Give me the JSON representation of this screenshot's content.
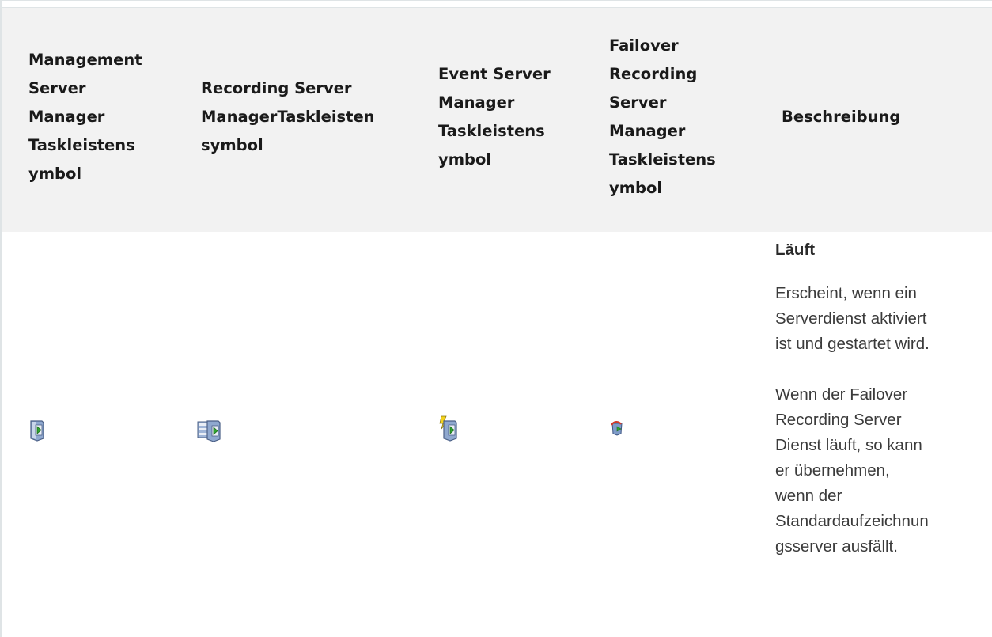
{
  "table": {
    "headers": [
      "Management\nServer\nManager\nTaskleistens\nymbol",
      "Recording Server\nManagerTaskleisten\nsymbol",
      "Event Server\nManager\nTaskleistens\nymbol",
      "Failover\nRecording\nServer\nManager\nTaskleistens\nymbol",
      "Beschreibung"
    ],
    "row": {
      "icons": [
        "management-server-running-icon",
        "recording-server-running-icon",
        "event-server-running-icon",
        "failover-recording-server-running-icon"
      ],
      "description": {
        "title": "Läuft",
        "p1": "Erscheint, wenn ein\nServerdienst aktiviert\nist und gestartet wird.",
        "p2": "Wenn der Failover\nRecording Server\nDienst läuft, so kann\ner übernehmen,\nwenn der\nStandardaufzeichnun\ngsserver ausfällt."
      }
    }
  },
  "colors": {
    "header_bg": "#f2f2f2",
    "border": "#dfe4e6",
    "run_green": "#2fa52f",
    "server_blue": "#7f9cc9"
  }
}
